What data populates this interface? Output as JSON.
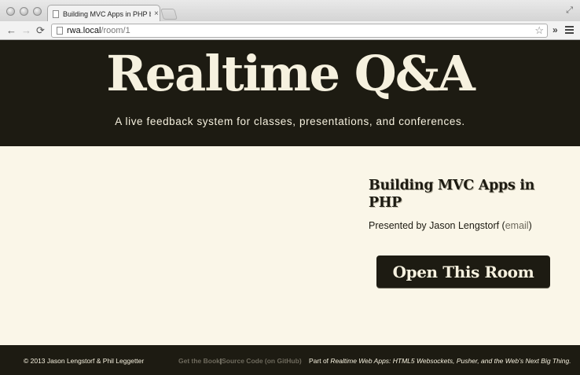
{
  "browser": {
    "tab_title": "Building MVC Apps in PHP by",
    "tab_close": "×",
    "url_host": "rwa.local",
    "url_path": "/room/1",
    "back_glyph": "←",
    "forward_glyph": "→",
    "reload_glyph": "⟳",
    "star_glyph": "☆",
    "extensions_glyph": "»"
  },
  "header": {
    "logo": "Realtime Q&A",
    "tagline": "A live feedback system for classes, presentations, and conferences."
  },
  "room": {
    "title": "Building MVC Apps in PHP",
    "presented_by": "Presented by Jason Lengstorf (",
    "email_link": "email",
    "presented_close": ")",
    "open_button": "Open This Room"
  },
  "footer": {
    "copyright": "© 2013 Jason Lengstorf & Phil Leggetter",
    "link_book": "Get the Book",
    "separator": "|",
    "link_source": "Source Code (on GitHub)",
    "part_prefix": "Part of ",
    "part_title": "Realtime Web Apps: HTML5 Websockets, Pusher, and the Web’s Next Big Thing."
  },
  "colors": {
    "dark": "#1d1b12",
    "cream": "#faf6e8",
    "muted_link": "#6e6a5d"
  }
}
